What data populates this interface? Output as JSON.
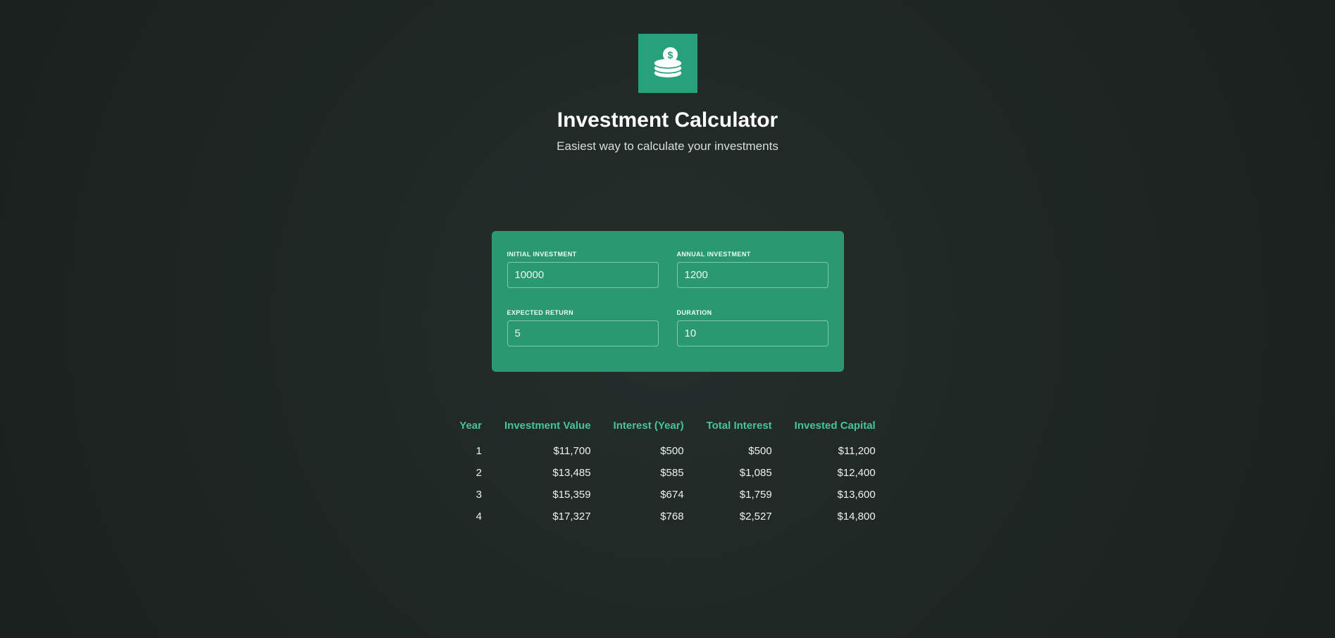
{
  "header": {
    "title": "Investment Calculator",
    "subtitle": "Easiest way to calculate your investments"
  },
  "form": {
    "initial_investment": {
      "label": "INITIAL INVESTMENT",
      "value": "10000"
    },
    "annual_investment": {
      "label": "ANNUAL INVESTMENT",
      "value": "1200"
    },
    "expected_return": {
      "label": "EXPECTED RETURN",
      "value": "5"
    },
    "duration": {
      "label": "DURATION",
      "value": "10"
    }
  },
  "table": {
    "headers": {
      "year": "Year",
      "investment_value": "Investment Value",
      "interest_year": "Interest (Year)",
      "total_interest": "Total Interest",
      "invested_capital": "Invested Capital"
    },
    "rows": [
      {
        "year": "1",
        "investment_value": "$11,700",
        "interest_year": "$500",
        "total_interest": "$500",
        "invested_capital": "$11,200"
      },
      {
        "year": "2",
        "investment_value": "$13,485",
        "interest_year": "$585",
        "total_interest": "$1,085",
        "invested_capital": "$12,400"
      },
      {
        "year": "3",
        "investment_value": "$15,359",
        "interest_year": "$674",
        "total_interest": "$1,759",
        "invested_capital": "$13,600"
      },
      {
        "year": "4",
        "investment_value": "$17,327",
        "interest_year": "$768",
        "total_interest": "$2,527",
        "invested_capital": "$14,800"
      }
    ]
  }
}
